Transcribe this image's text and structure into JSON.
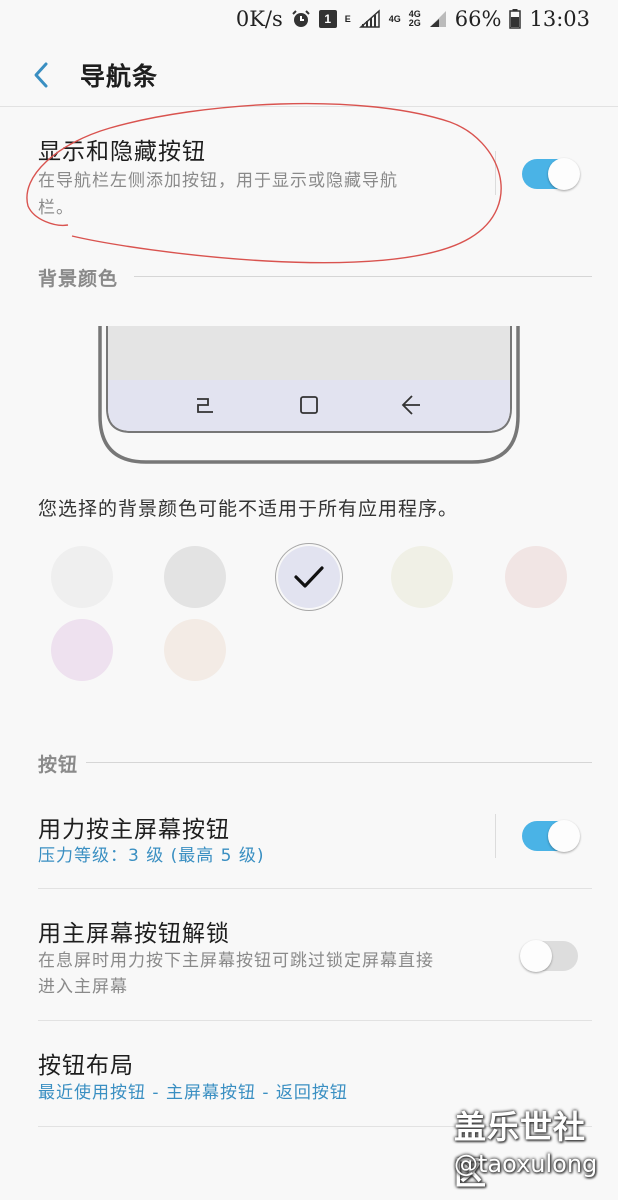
{
  "status_bar": {
    "speed": "0K/s",
    "notification_count": "1",
    "net_e": "E",
    "net_4g_a": "4G",
    "net_4g_b": "4G",
    "net_2g": "2G",
    "battery": "66%",
    "time": "13:03"
  },
  "header": {
    "title": "导航条"
  },
  "show_hide": {
    "title": "显示和隐藏按钮",
    "subtitle_line1": "在导航栏左侧添加按钮，用于显示或隐藏导航",
    "subtitle_line2": "栏。",
    "enabled": true
  },
  "background": {
    "header": "背景颜色",
    "note": "您选择的背景颜色可能不适用于所有应用程序。",
    "swatches": [
      {
        "color": "#efefef",
        "selected": false
      },
      {
        "color": "#e3e3e3",
        "selected": false
      },
      {
        "color": "#e2e3f0",
        "selected": true
      },
      {
        "color": "#f0f0e6",
        "selected": false
      },
      {
        "color": "#f1e5e4",
        "selected": false
      },
      {
        "color": "#eee1ef",
        "selected": false
      },
      {
        "color": "#f3ebe5",
        "selected": false
      }
    ]
  },
  "buttons": {
    "header": "按钮",
    "press_home": {
      "title": "用力按主屏幕按钮",
      "subtitle": "压力等级：3 级 (最高 5 级)",
      "enabled": true
    },
    "unlock": {
      "title": "用主屏幕按钮解锁",
      "subtitle_line1": "在息屏时用力按下主屏幕按钮可跳过锁定屏幕直接",
      "subtitle_line2": "进入主屏幕",
      "enabled": false
    },
    "layout": {
      "title": "按钮布局",
      "subtitle": "最近使用按钮 - 主屏幕按钮 - 返回按钮"
    }
  },
  "colors": {
    "accent": "#4ab3e6",
    "link": "#3a8fc2",
    "annotation": "#d9534f"
  },
  "watermark": {
    "line1": "盖乐世社区",
    "line2": "@taoxulong"
  }
}
